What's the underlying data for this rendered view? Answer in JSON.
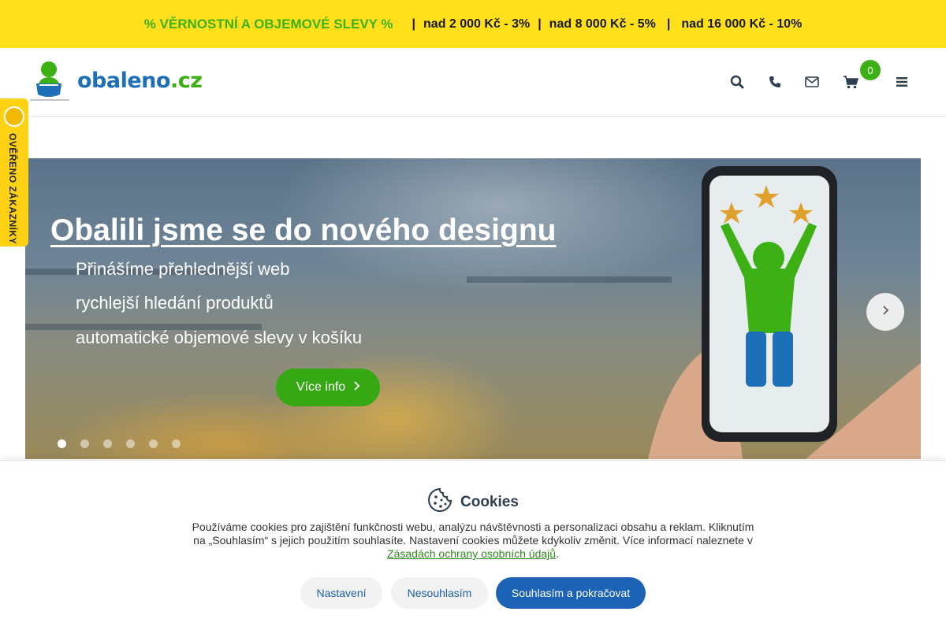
{
  "promo": {
    "highlight": "% VĚRNOSTNÍ A OBJEMOVÉ SLEVY %",
    "separator": "|",
    "tier1": "nad 2 000 Kč - 3%",
    "tier2": "nad 8 000 Kč - 5%",
    "tier3": "nad 16 000 Kč - 10%"
  },
  "header": {
    "logo_main": "obaleno",
    "logo_tld": ".cz",
    "cart_count": "0",
    "icons": [
      "search-icon",
      "phone-icon",
      "envelope-icon",
      "cart-icon",
      "menu-icon"
    ]
  },
  "side_badge": {
    "text": "OVĚŘENO ZÁKAZNÍKY"
  },
  "hero": {
    "title": "Obalili jsme se do nového designu",
    "lines": [
      "Přinášíme přehlednější web",
      "rychlejší hledání produktů",
      "automatické objemové slevy v košíku"
    ],
    "button_label": "Více info",
    "active_slide": 1,
    "slide_count": 6
  },
  "cookies": {
    "title": "Cookies",
    "text_1": "Používáme cookies pro zajištění funkčnosti webu, analýzu návštěvnosti a personalizaci obsahu a reklam. Kliknutím na „Souhlasím“ s jejich použitím souhlasíte. Nastavení cookies můžete kdykoliv změnit. Více informací naleznete v",
    "link_text": "Zásadách ochrany osobních údajů",
    "text_2": ".",
    "btn_settings": "Nastavení",
    "btn_decline": "Nesouhlasím",
    "btn_accept": "Souhlasím a pokračovat"
  },
  "colors": {
    "promo_bg": "#ffe01b",
    "brand_blue": "#1d6fb8",
    "brand_green": "#3cb014",
    "accept_blue": "#1d63b5"
  }
}
